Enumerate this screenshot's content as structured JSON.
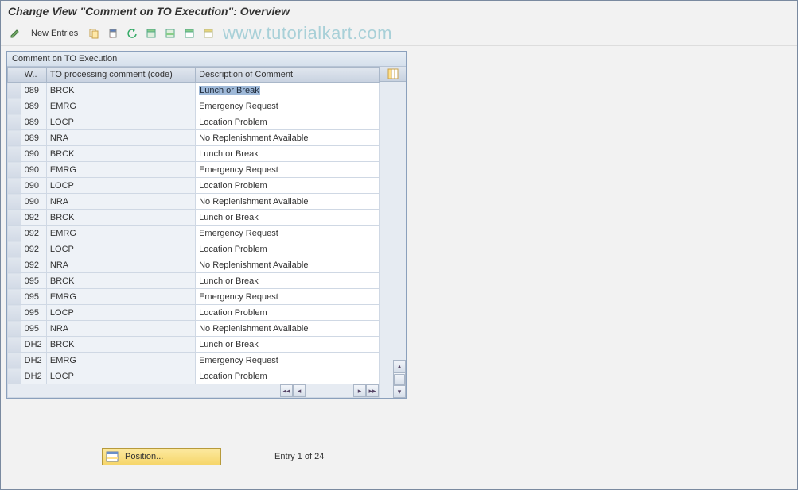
{
  "title": "Change View \"Comment on TO Execution\": Overview",
  "toolbar": {
    "new_entries_label": "New Entries"
  },
  "watermark": "www.tutorialkart.com",
  "panel": {
    "header": "Comment on TO Execution",
    "columns": {
      "w": "W..",
      "code": "TO processing comment (code)",
      "desc": "Description of Comment"
    },
    "rows": [
      {
        "w": "089",
        "code": "BRCK",
        "desc": "Lunch or Break",
        "highlight": true
      },
      {
        "w": "089",
        "code": "EMRG",
        "desc": "Emergency Request"
      },
      {
        "w": "089",
        "code": "LOCP",
        "desc": "Location Problem"
      },
      {
        "w": "089",
        "code": "NRA",
        "desc": "No Replenishment Available"
      },
      {
        "w": "090",
        "code": "BRCK",
        "desc": "Lunch or Break"
      },
      {
        "w": "090",
        "code": "EMRG",
        "desc": "Emergency Request"
      },
      {
        "w": "090",
        "code": "LOCP",
        "desc": "Location Problem"
      },
      {
        "w": "090",
        "code": "NRA",
        "desc": "No Replenishment Available"
      },
      {
        "w": "092",
        "code": "BRCK",
        "desc": "Lunch or Break"
      },
      {
        "w": "092",
        "code": "EMRG",
        "desc": "Emergency Request"
      },
      {
        "w": "092",
        "code": "LOCP",
        "desc": "Location Problem"
      },
      {
        "w": "092",
        "code": "NRA",
        "desc": "No Replenishment Available"
      },
      {
        "w": "095",
        "code": "BRCK",
        "desc": "Lunch or Break"
      },
      {
        "w": "095",
        "code": "EMRG",
        "desc": "Emergency Request"
      },
      {
        "w": "095",
        "code": "LOCP",
        "desc": "Location Problem"
      },
      {
        "w": "095",
        "code": "NRA",
        "desc": "No Replenishment Available"
      },
      {
        "w": "DH2",
        "code": "BRCK",
        "desc": "Lunch or Break"
      },
      {
        "w": "DH2",
        "code": "EMRG",
        "desc": "Emergency Request"
      },
      {
        "w": "DH2",
        "code": "LOCP",
        "desc": "Location Problem"
      }
    ]
  },
  "footer": {
    "position_label": "Position...",
    "entry_counter": "Entry 1 of 24"
  }
}
